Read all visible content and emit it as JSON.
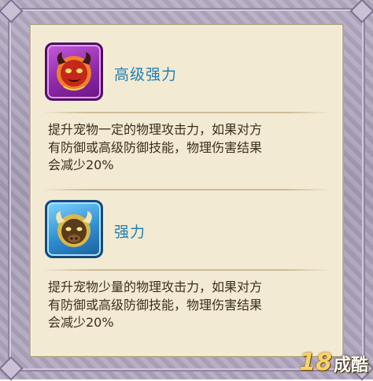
{
  "skills": [
    {
      "name": "高级强力",
      "icon": "red-demon-pet-icon",
      "description_lines": [
        "提升宠物一定的物理攻击力，如果对方",
        "有防御或高级防御技能，物理伤害结果",
        "会减少20%"
      ]
    },
    {
      "name": "强力",
      "icon": "golden-bull-pet-icon",
      "description_lines": [
        "提升宠物少量的物理攻击力，如果对方",
        "有防御或高级防御技能，物理伤害结果",
        "会减少20%"
      ]
    }
  ],
  "watermark": {
    "number": "18",
    "text": "成酷"
  },
  "colors": {
    "title": "#1f7fb3",
    "panel": "#f3ead3",
    "frame": "#a79db6",
    "advanced_icon_bg": "#8f2aa9",
    "basic_icon_bg": "#2f8fd1"
  }
}
